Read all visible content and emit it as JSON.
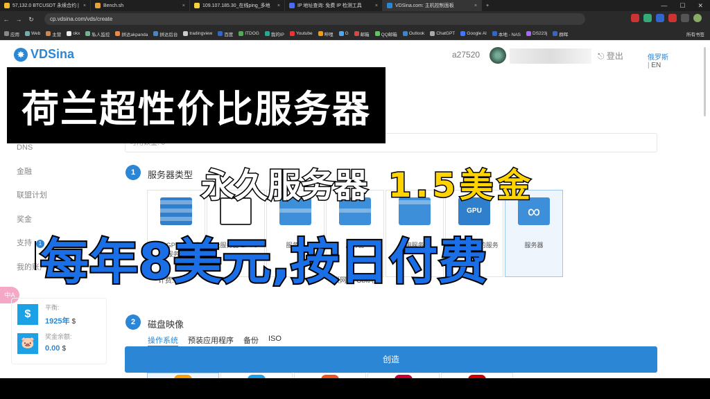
{
  "tabs": [
    {
      "label": "57,132.0 BTCUSDT 永续合约 |",
      "fav": "#f3ba2f"
    },
    {
      "label": "Bench.sh",
      "fav": "#e8a23a"
    },
    {
      "label": "109.107.185.30_在线ping_多地",
      "fav": "#f4d03f"
    },
    {
      "label": "IP 地址查询: 免费 IP 检测工具",
      "fav": "#4a6cf7"
    },
    {
      "label": "VDSina.com: 主机控制面板",
      "fav": "#2b87d6"
    }
  ],
  "url": "cp.vdsina.com/vds/create",
  "bookmarks": [
    "应用",
    "Web",
    "主营",
    "okx",
    "私人监控",
    "拼达akpanda",
    "拼达后台",
    "tradingview",
    "百度",
    "ITDOG",
    "我的IP",
    "Youtube",
    "哔哩",
    "G",
    "邮箱",
    "QQ邮箱",
    "Outlook",
    "ChatGPT",
    "Google AI",
    "本地 - NAS",
    "DS223j",
    "群晖"
  ],
  "bookmarks_right": "所有书签",
  "brand": "VDSina",
  "user": "a27520",
  "logout": "登出",
  "lang": {
    "ru": "俄罗斯",
    "sep": "|",
    "en": "EN"
  },
  "sidebar": [
    {
      "label": "DNS",
      "badge": null
    },
    {
      "label": "金融",
      "badge": null
    },
    {
      "label": "联盟计划",
      "badge": null
    },
    {
      "label": "奖金",
      "badge": null
    },
    {
      "label": "支持",
      "badge": "1"
    },
    {
      "label": "我的账户",
      "badge": null
    }
  ],
  "side_pill": "中A",
  "balance": {
    "label": "平衡:",
    "value": "1925年",
    "currency": "$"
  },
  "bonus": {
    "label": "奖金余额:",
    "value": "0.00",
    "currency": "$"
  },
  "counter_text": "可用数量: 0",
  "step1": {
    "num": "1",
    "title": "服务器类型"
  },
  "server_types": [
    {
      "label": "配备 GPU 的标准服务器",
      "icon": "gpu",
      "selected": false
    },
    {
      "label": "云服务器 EPYC",
      "icon": "epyc",
      "selected": false
    },
    {
      "label": "服务器",
      "icon": "server",
      "selected": false
    },
    {
      "label": "服务器",
      "icon": "server",
      "selected": false
    },
    {
      "label": "专用服务器",
      "icon": "server",
      "selected": false
    },
    {
      "label": "配备 GPU 的服务器",
      "icon": "gpu",
      "selected": false
    },
    {
      "label": "服务器",
      "icon": "infinity",
      "selected": true
    }
  ],
  "desc_left": "计费...",
  "desc_right": "联网 ... Gbit/秒。",
  "step2": {
    "num": "2",
    "title": "磁盘映像"
  },
  "disk_tabs": [
    "操作系统",
    "预装应用程序",
    "备份",
    "ISO"
  ],
  "create_label": "创造",
  "overlay": {
    "headline": "荷兰超性价比服务器",
    "permanent": "永久服务器",
    "price": "1.5美金",
    "bottom": "每年8美元,按日付费"
  },
  "colors": {
    "accent": "#2b87d6",
    "overlay_blue": "#1a6fe6",
    "overlay_yellow": "#ffd400"
  }
}
